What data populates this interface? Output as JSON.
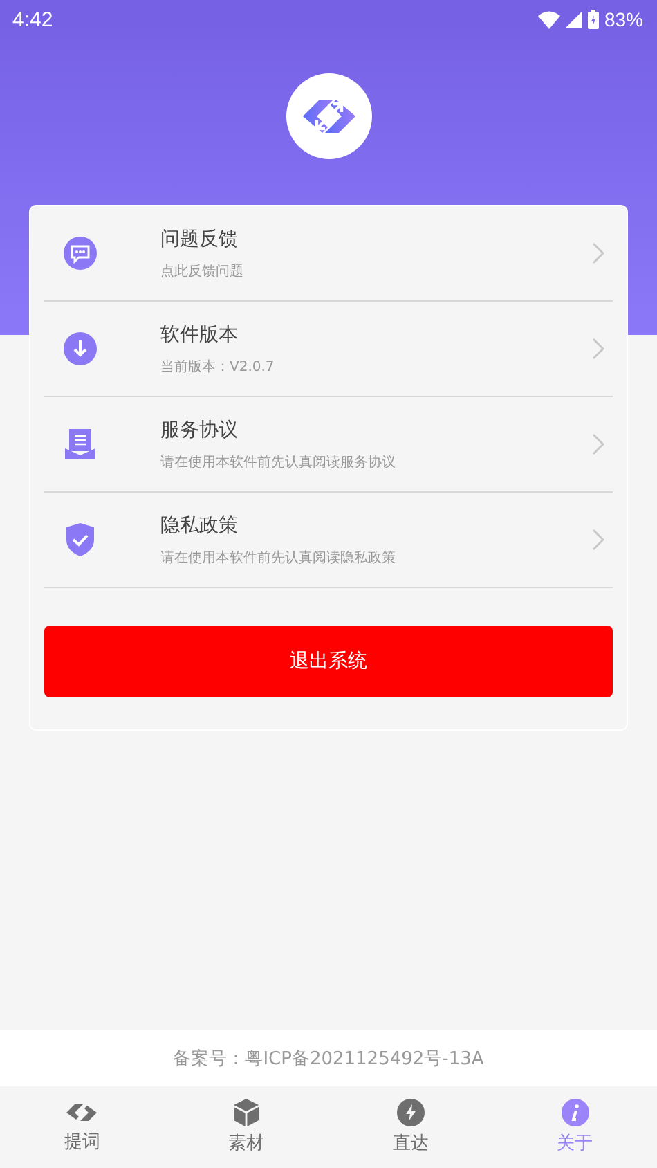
{
  "status_bar": {
    "time": "4:42",
    "battery": "83%"
  },
  "menu": [
    {
      "kind": "feedback",
      "title": "问题反馈",
      "subtitle": "点此反馈问题"
    },
    {
      "kind": "version",
      "title": "软件版本",
      "subtitle": "当前版本：V2.0.7"
    },
    {
      "kind": "agreement",
      "title": "服务协议",
      "subtitle": "请在使用本软件前先认真阅读服务协议"
    },
    {
      "kind": "privacy",
      "title": "隐私政策",
      "subtitle": "请在使用本软件前先认真阅读隐私政策"
    }
  ],
  "logout_button": "退出系统",
  "footer": "备案号：粤ICP备2021125492号-13A",
  "tabs": [
    {
      "kind": "link",
      "label": "提词",
      "selected": false
    },
    {
      "kind": "box",
      "label": "素材",
      "selected": false
    },
    {
      "kind": "bolt",
      "label": "直达",
      "selected": false
    },
    {
      "kind": "info",
      "label": "关于",
      "selected": true
    }
  ]
}
